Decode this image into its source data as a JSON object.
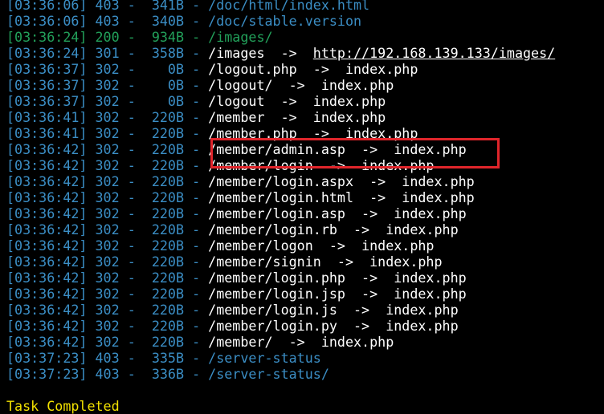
{
  "colors": {
    "background": "#000000",
    "status_403": "#3b8ec5",
    "status_200": "#22a05a",
    "status_30x": "#3b8ec5",
    "redirect_target": "#ffffff",
    "highlight_box": "#e0252b",
    "completed": "#f2e100"
  },
  "log": [
    {
      "time": "[03:36:06]",
      "status": "403",
      "size": "341B",
      "path": "/doc/html/index.html",
      "redirect": "",
      "color": "blue"
    },
    {
      "time": "[03:36:06]",
      "status": "403",
      "size": "340B",
      "path": "/doc/stable.version",
      "redirect": "",
      "color": "blue"
    },
    {
      "time": "[03:36:24]",
      "status": "200",
      "size": "934B",
      "path": "/images/",
      "redirect": "",
      "color": "green"
    },
    {
      "time": "[03:36:24]",
      "status": "301",
      "size": "358B",
      "path": "/images",
      "redirect": "http://192.168.139.133/images/",
      "color": "blue",
      "redirect_underline": true
    },
    {
      "time": "[03:36:37]",
      "status": "302",
      "size": "0B",
      "path": "/logout.php",
      "redirect": "index.php",
      "color": "blue"
    },
    {
      "time": "[03:36:37]",
      "status": "302",
      "size": "0B",
      "path": "/logout/",
      "redirect": "index.php",
      "color": "blue"
    },
    {
      "time": "[03:36:37]",
      "status": "302",
      "size": "0B",
      "path": "/logout",
      "redirect": "index.php",
      "color": "blue"
    },
    {
      "time": "[03:36:41]",
      "status": "302",
      "size": "220B",
      "path": "/member",
      "redirect": "index.php",
      "color": "blue"
    },
    {
      "time": "[03:36:41]",
      "status": "302",
      "size": "220B",
      "path": "/member.php",
      "redirect": "index.php",
      "color": "blue"
    },
    {
      "time": "[03:36:42]",
      "status": "302",
      "size": "220B",
      "path": "/member/admin.asp",
      "redirect": "index.php",
      "color": "blue"
    },
    {
      "time": "[03:36:42]",
      "status": "302",
      "size": "220B",
      "path": "/member/login",
      "redirect": "index.php",
      "color": "blue"
    },
    {
      "time": "[03:36:42]",
      "status": "302",
      "size": "220B",
      "path": "/member/login.aspx",
      "redirect": "index.php",
      "color": "blue"
    },
    {
      "time": "[03:36:42]",
      "status": "302",
      "size": "220B",
      "path": "/member/login.html",
      "redirect": "index.php",
      "color": "blue"
    },
    {
      "time": "[03:36:42]",
      "status": "302",
      "size": "220B",
      "path": "/member/login.asp",
      "redirect": "index.php",
      "color": "blue"
    },
    {
      "time": "[03:36:42]",
      "status": "302",
      "size": "220B",
      "path": "/member/login.rb",
      "redirect": "index.php",
      "color": "blue"
    },
    {
      "time": "[03:36:42]",
      "status": "302",
      "size": "220B",
      "path": "/member/logon",
      "redirect": "index.php",
      "color": "blue"
    },
    {
      "time": "[03:36:42]",
      "status": "302",
      "size": "220B",
      "path": "/member/signin",
      "redirect": "index.php",
      "color": "blue"
    },
    {
      "time": "[03:36:42]",
      "status": "302",
      "size": "220B",
      "path": "/member/login.php",
      "redirect": "index.php",
      "color": "blue"
    },
    {
      "time": "[03:36:42]",
      "status": "302",
      "size": "220B",
      "path": "/member/login.jsp",
      "redirect": "index.php",
      "color": "blue"
    },
    {
      "time": "[03:36:42]",
      "status": "302",
      "size": "220B",
      "path": "/member/login.js",
      "redirect": "index.php",
      "color": "blue"
    },
    {
      "time": "[03:36:42]",
      "status": "302",
      "size": "220B",
      "path": "/member/login.py",
      "redirect": "index.php",
      "color": "blue"
    },
    {
      "time": "[03:36:42]",
      "status": "302",
      "size": "220B",
      "path": "/member/",
      "redirect": "index.php",
      "color": "blue"
    },
    {
      "time": "[03:37:23]",
      "status": "403",
      "size": "335B",
      "path": "/server-status",
      "redirect": "",
      "color": "blue"
    },
    {
      "time": "[03:37:23]",
      "status": "403",
      "size": "336B",
      "path": "/server-status/",
      "redirect": "",
      "color": "blue"
    }
  ],
  "footer": {
    "completed_text": "Task Completed"
  }
}
